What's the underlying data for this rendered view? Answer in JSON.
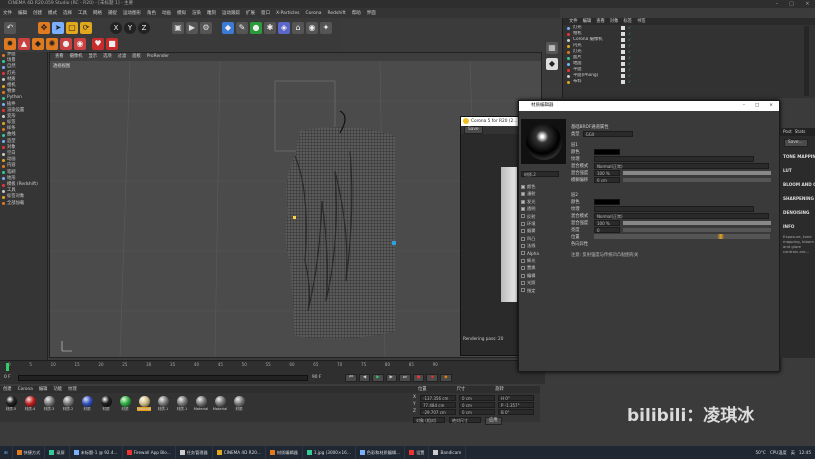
{
  "window": {
    "title": "CINEMA 4D R20.059 Studio (RC - R20) - [未标题 1] - 主要"
  },
  "menu": [
    "文件",
    "编辑",
    "创建",
    "模式",
    "选择",
    "工具",
    "网格",
    "捕捉",
    "运动图形",
    "角色",
    "动画",
    "模拟",
    "渲染",
    "雕刻",
    "运动跟踪",
    "扩展",
    "窗口",
    "X-Particles",
    "Corona",
    "Redshift",
    "帮助",
    "界面"
  ],
  "toolbar": {
    "axis": [
      "X",
      "Y",
      "Z"
    ]
  },
  "left_tree": [
    "界面",
    "场景",
    "自然",
    "灯光",
    "材质",
    "相机",
    "物体",
    "Python",
    "插件",
    "渲染设置",
    "变形",
    "标签",
    "样条",
    "曲线",
    "造型",
    "对象",
    "空白",
    "动画",
    "内容",
    "笔刷",
    "地形",
    "模板 (Redshift)",
    "工具",
    "标签对象",
    "全部加载"
  ],
  "viewport": {
    "menu": [
      "查看",
      "摄像机",
      "显示",
      "选项",
      "过滤",
      "面板",
      "ProRender"
    ],
    "label": "透视视图"
  },
  "timeline": {
    "ticks": [
      "0",
      "5",
      "10",
      "15",
      "20",
      "25",
      "30",
      "35",
      "40",
      "45",
      "50",
      "55",
      "60",
      "65",
      "70",
      "75",
      "80",
      "85",
      "90"
    ],
    "start": "0 F",
    "end": "90 F",
    "current": "0 F"
  },
  "materials": {
    "menu": [
      "创建",
      "Corona",
      "编辑",
      "功能",
      "纹理"
    ],
    "items": [
      "材质.5",
      "材质.4",
      "材质.3",
      "材质.2",
      "材质",
      "材质",
      "材质",
      "Material",
      "材质.1",
      "材质.1",
      "Material",
      "Material",
      "材质"
    ]
  },
  "coords": {
    "headers": [
      "位置",
      "尺寸",
      "旋转"
    ],
    "rows": [
      {
        "axis": "X",
        "pos": "-137.356 cm",
        "size": "0 cm",
        "rot": "H 0°"
      },
      {
        "axis": "Y",
        "pos": "77.484 cm",
        "size": "0 cm",
        "rot": "P -1.357°"
      },
      {
        "axis": "Z",
        "pos": "-29.707 cm",
        "size": "0 cm",
        "rot": "B 0°"
      }
    ],
    "mode": "对象 (相对)",
    "size_mode": "绝对尺寸",
    "apply": "应用"
  },
  "objects": {
    "menu": [
      "文件",
      "编辑",
      "查看",
      "对象",
      "标签",
      "书签"
    ],
    "items": [
      "灯光",
      "相机",
      "Corona 摄像机",
      "闪光",
      "灯光",
      "面片",
      "地面",
      "平面",
      "平面(Phong)",
      "布料"
    ]
  },
  "corona": {
    "title": "Corona 5 for R20 (2...",
    "save": "Save",
    "status": "Rendering pass: 20"
  },
  "material_editor": {
    "title": "材质编辑器",
    "mat_name": "材质.2",
    "channels": [
      "颜色",
      "漫射",
      "发光",
      "透明",
      "反射",
      "环境",
      "烟雾",
      "凹凸",
      "法线",
      "Alpha",
      "辉光",
      "置换",
      "编辑",
      "光照",
      "指定"
    ],
    "header": "基础BRDF通道属性",
    "type_label": "类型",
    "type_value": "GGX",
    "section1": "层1",
    "color_label": "颜色",
    "texture_label": "纹理",
    "blend_label": "混合模式",
    "blend_value": "Normal(正常)",
    "mix_label": "混合强度",
    "mix_value": "100 %",
    "blur_label": "模糊偏移",
    "blur_value": "0 cm",
    "section2": "层2",
    "color2_label": "颜色",
    "texture2_label": "纹理",
    "blend2_label": "混合模式",
    "blend2_value": "Normal(正常)",
    "mix2_label": "混合强度",
    "mix2_value": "100 %",
    "bright_label": "亮度",
    "bright_value": "0",
    "pos_label": "位置",
    "aniso_label": "各向异性",
    "note": "注意: 反射强度与传统凹凸贴图有关"
  },
  "post_panel": {
    "tabs": [
      "Post",
      "Stats"
    ],
    "save": "Save...",
    "sections": [
      "TONE MAPPING",
      "LUT",
      "BLOOM AND GLARE",
      "SHARPENING",
      "DENOISING",
      "INFO"
    ],
    "info_text": "Exposure, tone mapping, bloom and glare controls are..."
  },
  "watermark": "bilibili：凌琪冰",
  "taskbar": {
    "items": [
      "快捷方式",
      "录屏",
      "未标题-1 @ 92.4...",
      "Firewall App Blo...",
      "任务管理器",
      "CINEMA 4D R20...",
      "材质编辑器",
      "1.jpg (3000×16...",
      "色彩和材质编辑...",
      "设置",
      "Bandicam"
    ],
    "temp": "50°C",
    "temp_label": "CPU温度",
    "time": "12:45",
    "lang": "英"
  }
}
